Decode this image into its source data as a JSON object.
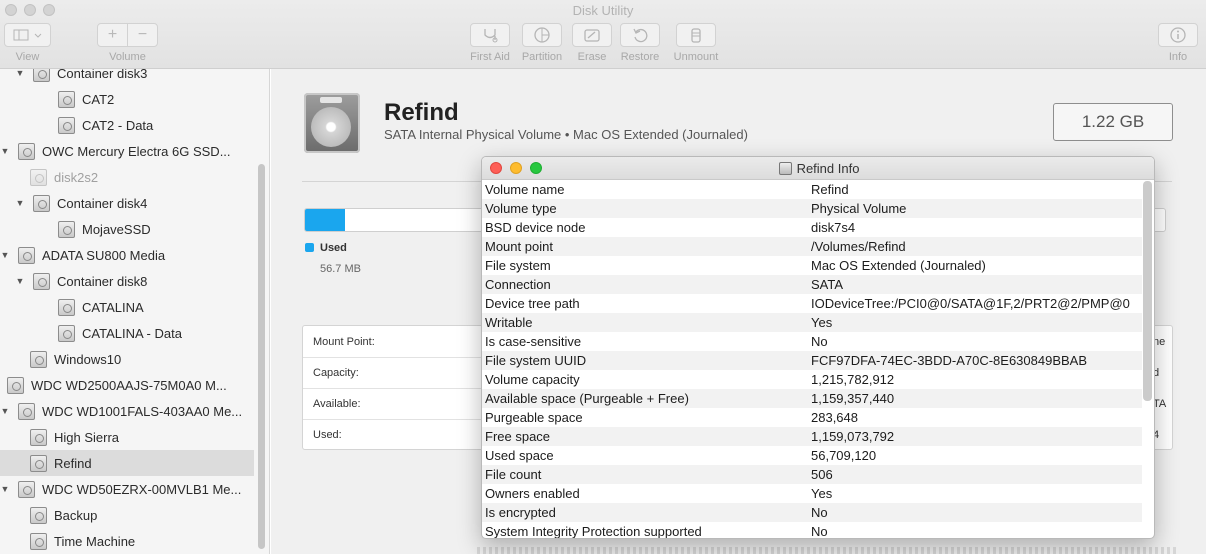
{
  "window": {
    "title": "Disk Utility"
  },
  "toolbar": {
    "view_label": "View",
    "volume_label": "Volume",
    "first_aid_label": "First Aid",
    "partition_label": "Partition",
    "erase_label": "Erase",
    "restore_label": "Restore",
    "unmount_label": "Unmount",
    "info_label": "Info"
  },
  "sidebar": {
    "items": [
      {
        "label": "Container disk3",
        "level": 1,
        "expanded": true,
        "dim": false,
        "selected": false
      },
      {
        "label": "CAT2",
        "level": 2,
        "dim": false,
        "selected": false
      },
      {
        "label": "CAT2 - Data",
        "level": 2,
        "dim": false,
        "selected": false
      },
      {
        "label": "OWC Mercury Electra 6G SSD...",
        "level": 0,
        "expanded": true,
        "dim": false,
        "selected": false
      },
      {
        "label": "disk2s2",
        "level": 1,
        "dim": true,
        "selected": false
      },
      {
        "label": "Container disk4",
        "level": 1,
        "expanded": true,
        "dim": false,
        "selected": false
      },
      {
        "label": "MojaveSSD",
        "level": 2,
        "dim": false,
        "selected": false
      },
      {
        "label": "ADATA SU800 Media",
        "level": 0,
        "expanded": true,
        "dim": false,
        "selected": false
      },
      {
        "label": "Container disk8",
        "level": 1,
        "expanded": true,
        "dim": false,
        "selected": false
      },
      {
        "label": "CATALINA",
        "level": 2,
        "dim": false,
        "selected": false
      },
      {
        "label": "CATALINA - Data",
        "level": 2,
        "dim": false,
        "selected": false
      },
      {
        "label": "Windows10",
        "level": 1,
        "dim": false,
        "selected": false
      },
      {
        "label": "WDC WD2500AAJS-75M0A0 M...",
        "level": 0,
        "dim": false,
        "selected": false
      },
      {
        "label": "WDC WD1001FALS-403AA0 Me...",
        "level": 0,
        "expanded": true,
        "dim": false,
        "selected": false
      },
      {
        "label": "High Sierra",
        "level": 1,
        "dim": false,
        "selected": false
      },
      {
        "label": "Refind",
        "level": 1,
        "dim": false,
        "selected": true
      },
      {
        "label": "WDC WD50EZRX-00MVLB1 Me...",
        "level": 0,
        "expanded": true,
        "dim": false,
        "selected": false
      },
      {
        "label": "Backup",
        "level": 1,
        "dim": false,
        "selected": false
      },
      {
        "label": "Time Machine",
        "level": 1,
        "dim": false,
        "selected": false
      }
    ]
  },
  "volume": {
    "name": "Refind",
    "subtitle": "SATA Internal Physical Volume • Mac OS Extended (Journaled)",
    "size": "1.22 GB",
    "used_fraction": 0.047,
    "used_label": "Used",
    "used_value": "56.7 MB"
  },
  "details": {
    "rows": [
      {
        "label": "Mount Point:",
        "right": "ne"
      },
      {
        "label": "Capacity:",
        "right": "d"
      },
      {
        "label": "Available:",
        "right": "TA"
      },
      {
        "label": "Used:",
        "right": "4"
      }
    ]
  },
  "info_window": {
    "title": "Refind Info",
    "rows": [
      {
        "key": "Volume name",
        "value": "Refind"
      },
      {
        "key": "Volume type",
        "value": "Physical Volume"
      },
      {
        "key": "BSD device node",
        "value": "disk7s4"
      },
      {
        "key": "Mount point",
        "value": "/Volumes/Refind"
      },
      {
        "key": "File system",
        "value": "Mac OS Extended (Journaled)"
      },
      {
        "key": "Connection",
        "value": "SATA"
      },
      {
        "key": "Device tree path",
        "value": "IODeviceTree:/PCI0@0/SATA@1F,2/PRT2@2/PMP@0"
      },
      {
        "key": "Writable",
        "value": "Yes"
      },
      {
        "key": "Is case-sensitive",
        "value": "No"
      },
      {
        "key": "File system UUID",
        "value": "FCF97DFA-74EC-3BDD-A70C-8E630849BBAB"
      },
      {
        "key": "Volume capacity",
        "value": "1,215,782,912"
      },
      {
        "key": "Available space (Purgeable + Free)",
        "value": "1,159,357,440"
      },
      {
        "key": "Purgeable space",
        "value": "283,648"
      },
      {
        "key": "Free space",
        "value": "1,159,073,792"
      },
      {
        "key": "Used space",
        "value": "56,709,120"
      },
      {
        "key": "File count",
        "value": "506"
      },
      {
        "key": "Owners enabled",
        "value": "Yes"
      },
      {
        "key": "Is encrypted",
        "value": "No"
      },
      {
        "key": "System Integrity Protection supported",
        "value": "No"
      }
    ]
  },
  "colors": {
    "accent": "#1aa6ee",
    "close": "#fe5f57",
    "minimize": "#febc2e",
    "zoom": "#28c840"
  }
}
